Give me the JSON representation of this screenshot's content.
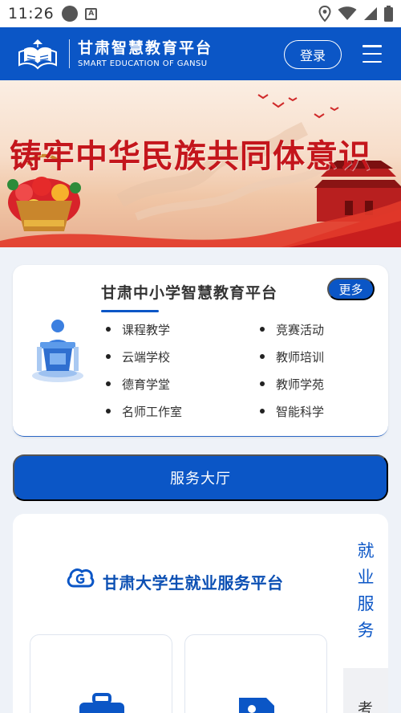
{
  "status_bar": {
    "time": "11:26",
    "icons": [
      "circle-notification-icon",
      "a-notification-icon",
      "location-icon",
      "wifi-icon",
      "signal-icon",
      "battery-icon"
    ]
  },
  "header": {
    "title_cn": "甘肃智慧教育平台",
    "title_en": "SMART EDUCATION OF GANSU",
    "login_label": "登录",
    "menu_icon": "hamburger-menu-icon"
  },
  "banner": {
    "headline": "铸牢中华民族共同体意识"
  },
  "platform_card": {
    "title": "甘肃中小学智慧教育平台",
    "more_label": "更多",
    "links": [
      "课程教学",
      "竞赛活动",
      "云端学校",
      "教师培训",
      "德育学堂",
      "教师学苑",
      "名师工作室",
      "智能科学"
    ]
  },
  "service_hall": {
    "label": "服务大厅"
  },
  "jobs_section": {
    "title": "甘肃大学生就业服务平台",
    "side_tab": [
      "就",
      "业",
      "服",
      "务"
    ],
    "side_tab_next": "考"
  },
  "colors": {
    "primary": "#0b56c6",
    "banner_red": "#c4161c",
    "background": "#eef2f8"
  }
}
